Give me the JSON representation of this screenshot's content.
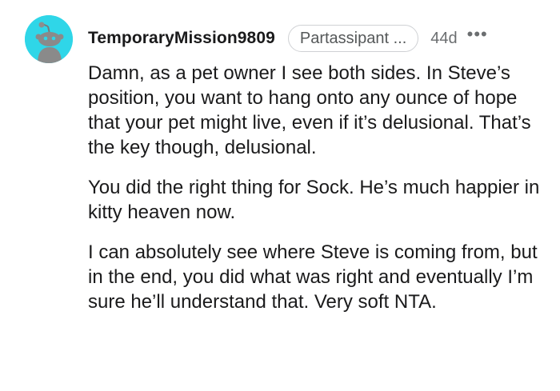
{
  "comment": {
    "username": "TemporaryMission9809",
    "flair": "Partassipant ...",
    "age": "44d",
    "more_icon": "•••",
    "avatar_icon": "snoo-avatar-icon",
    "avatar_color": "#2fd6e8",
    "paragraphs": [
      "Damn, as a pet owner I see both sides. In Steve’s position, you want to hang onto any ounce of hope that your pet might live, even if it’s delusional. That’s the key though, delusional.",
      "You did the right thing for Sock. He’s much happier in kitty heaven now.",
      "I can absolutely see where Steve is coming from, but in the end, you did what was right and eventually I’m sure he’ll understand that. Very soft NTA."
    ]
  }
}
